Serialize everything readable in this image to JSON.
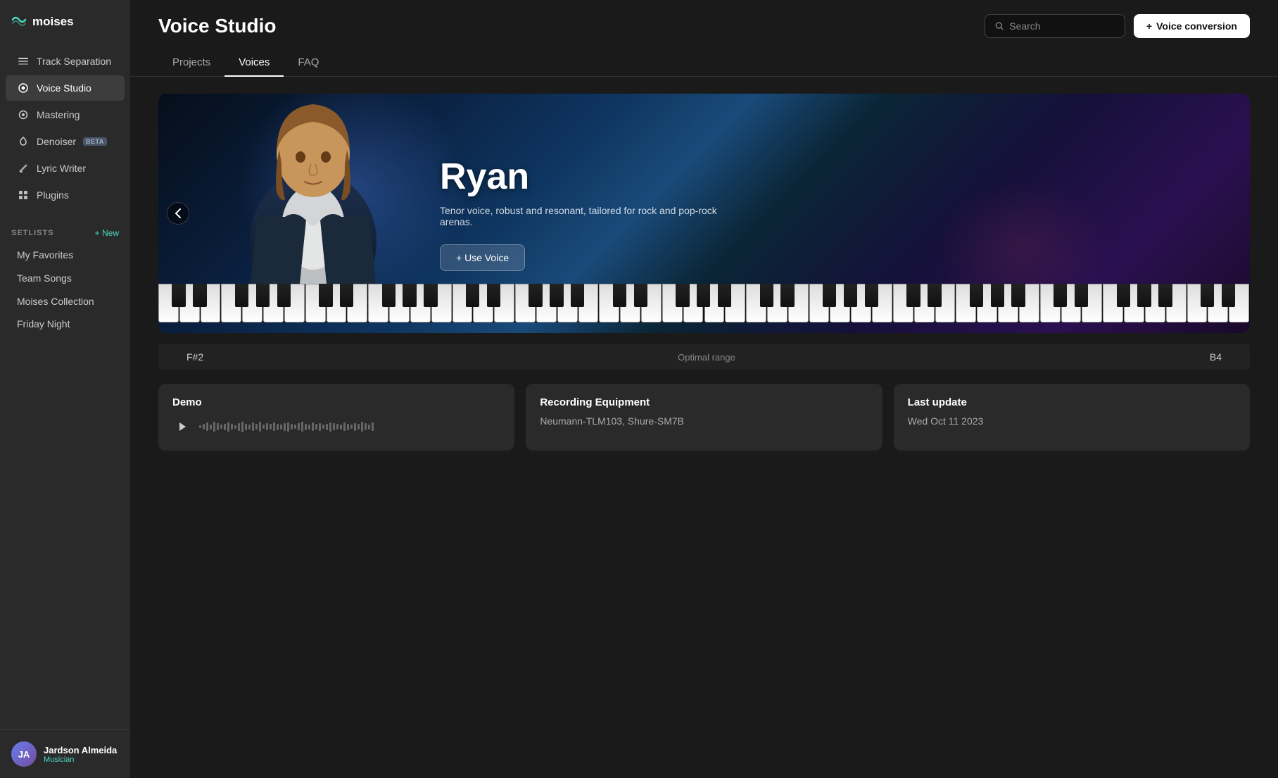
{
  "app": {
    "logo_text": "moises",
    "logo_icon": "≋"
  },
  "sidebar": {
    "nav_items": [
      {
        "id": "track-separation",
        "label": "Track Separation",
        "icon": "⊞",
        "active": false
      },
      {
        "id": "voice-studio",
        "label": "Voice Studio",
        "icon": "◉",
        "active": true
      },
      {
        "id": "mastering",
        "label": "Mastering",
        "icon": "⊙",
        "active": false
      },
      {
        "id": "denoiser",
        "label": "Denoiser",
        "icon": "◎",
        "active": false,
        "badge": "BETA"
      },
      {
        "id": "lyric-writer",
        "label": "Lyric Writer",
        "icon": "✎",
        "active": false
      },
      {
        "id": "plugins",
        "label": "Plugins",
        "icon": "⊞",
        "active": false
      }
    ],
    "setlists_label": "SETLISTS",
    "new_label": "+ New",
    "setlist_items": [
      {
        "id": "my-favorites",
        "label": "My Favorites",
        "has_icon": false
      },
      {
        "id": "team-songs",
        "label": "Team Songs",
        "has_icon": true
      },
      {
        "id": "moises-collection",
        "label": "Moises Collection",
        "has_icon": true
      },
      {
        "id": "friday-night",
        "label": "Friday Night",
        "has_icon": false
      }
    ]
  },
  "user": {
    "name": "Jardson Almeida",
    "role": "Musician",
    "initials": "JA"
  },
  "header": {
    "title": "Voice Studio",
    "search_placeholder": "Search",
    "voice_conversion_label": "Voice conversion",
    "plus": "+"
  },
  "tabs": [
    {
      "id": "projects",
      "label": "Projects",
      "active": false
    },
    {
      "id": "voices",
      "label": "Voices",
      "active": true
    },
    {
      "id": "faq",
      "label": "FAQ",
      "active": false
    }
  ],
  "voice": {
    "name": "Ryan",
    "description": "Tenor voice, robust and resonant, tailored for rock and pop-rock arenas.",
    "use_voice_label": "+ Use Voice",
    "range_start": "F#2",
    "range_label": "Optimal range",
    "range_end": "B4"
  },
  "demo_card": {
    "title": "Demo",
    "waveform_bars": [
      4,
      8,
      12,
      7,
      14,
      10,
      6,
      9,
      13,
      8,
      5,
      11,
      15,
      9,
      7,
      12,
      8,
      14,
      6,
      10,
      8,
      12,
      9,
      7,
      11,
      13,
      8,
      6,
      10,
      14,
      9,
      7,
      12,
      8,
      11,
      6,
      9,
      13,
      10,
      8,
      7,
      12,
      9,
      6,
      11,
      8,
      14,
      10,
      7,
      12
    ]
  },
  "recording_card": {
    "title": "Recording Equipment",
    "equipment": "Neumann-TLM103, Shure-SM7B"
  },
  "last_update_card": {
    "title": "Last update",
    "date": "Wed Oct 11 2023"
  }
}
